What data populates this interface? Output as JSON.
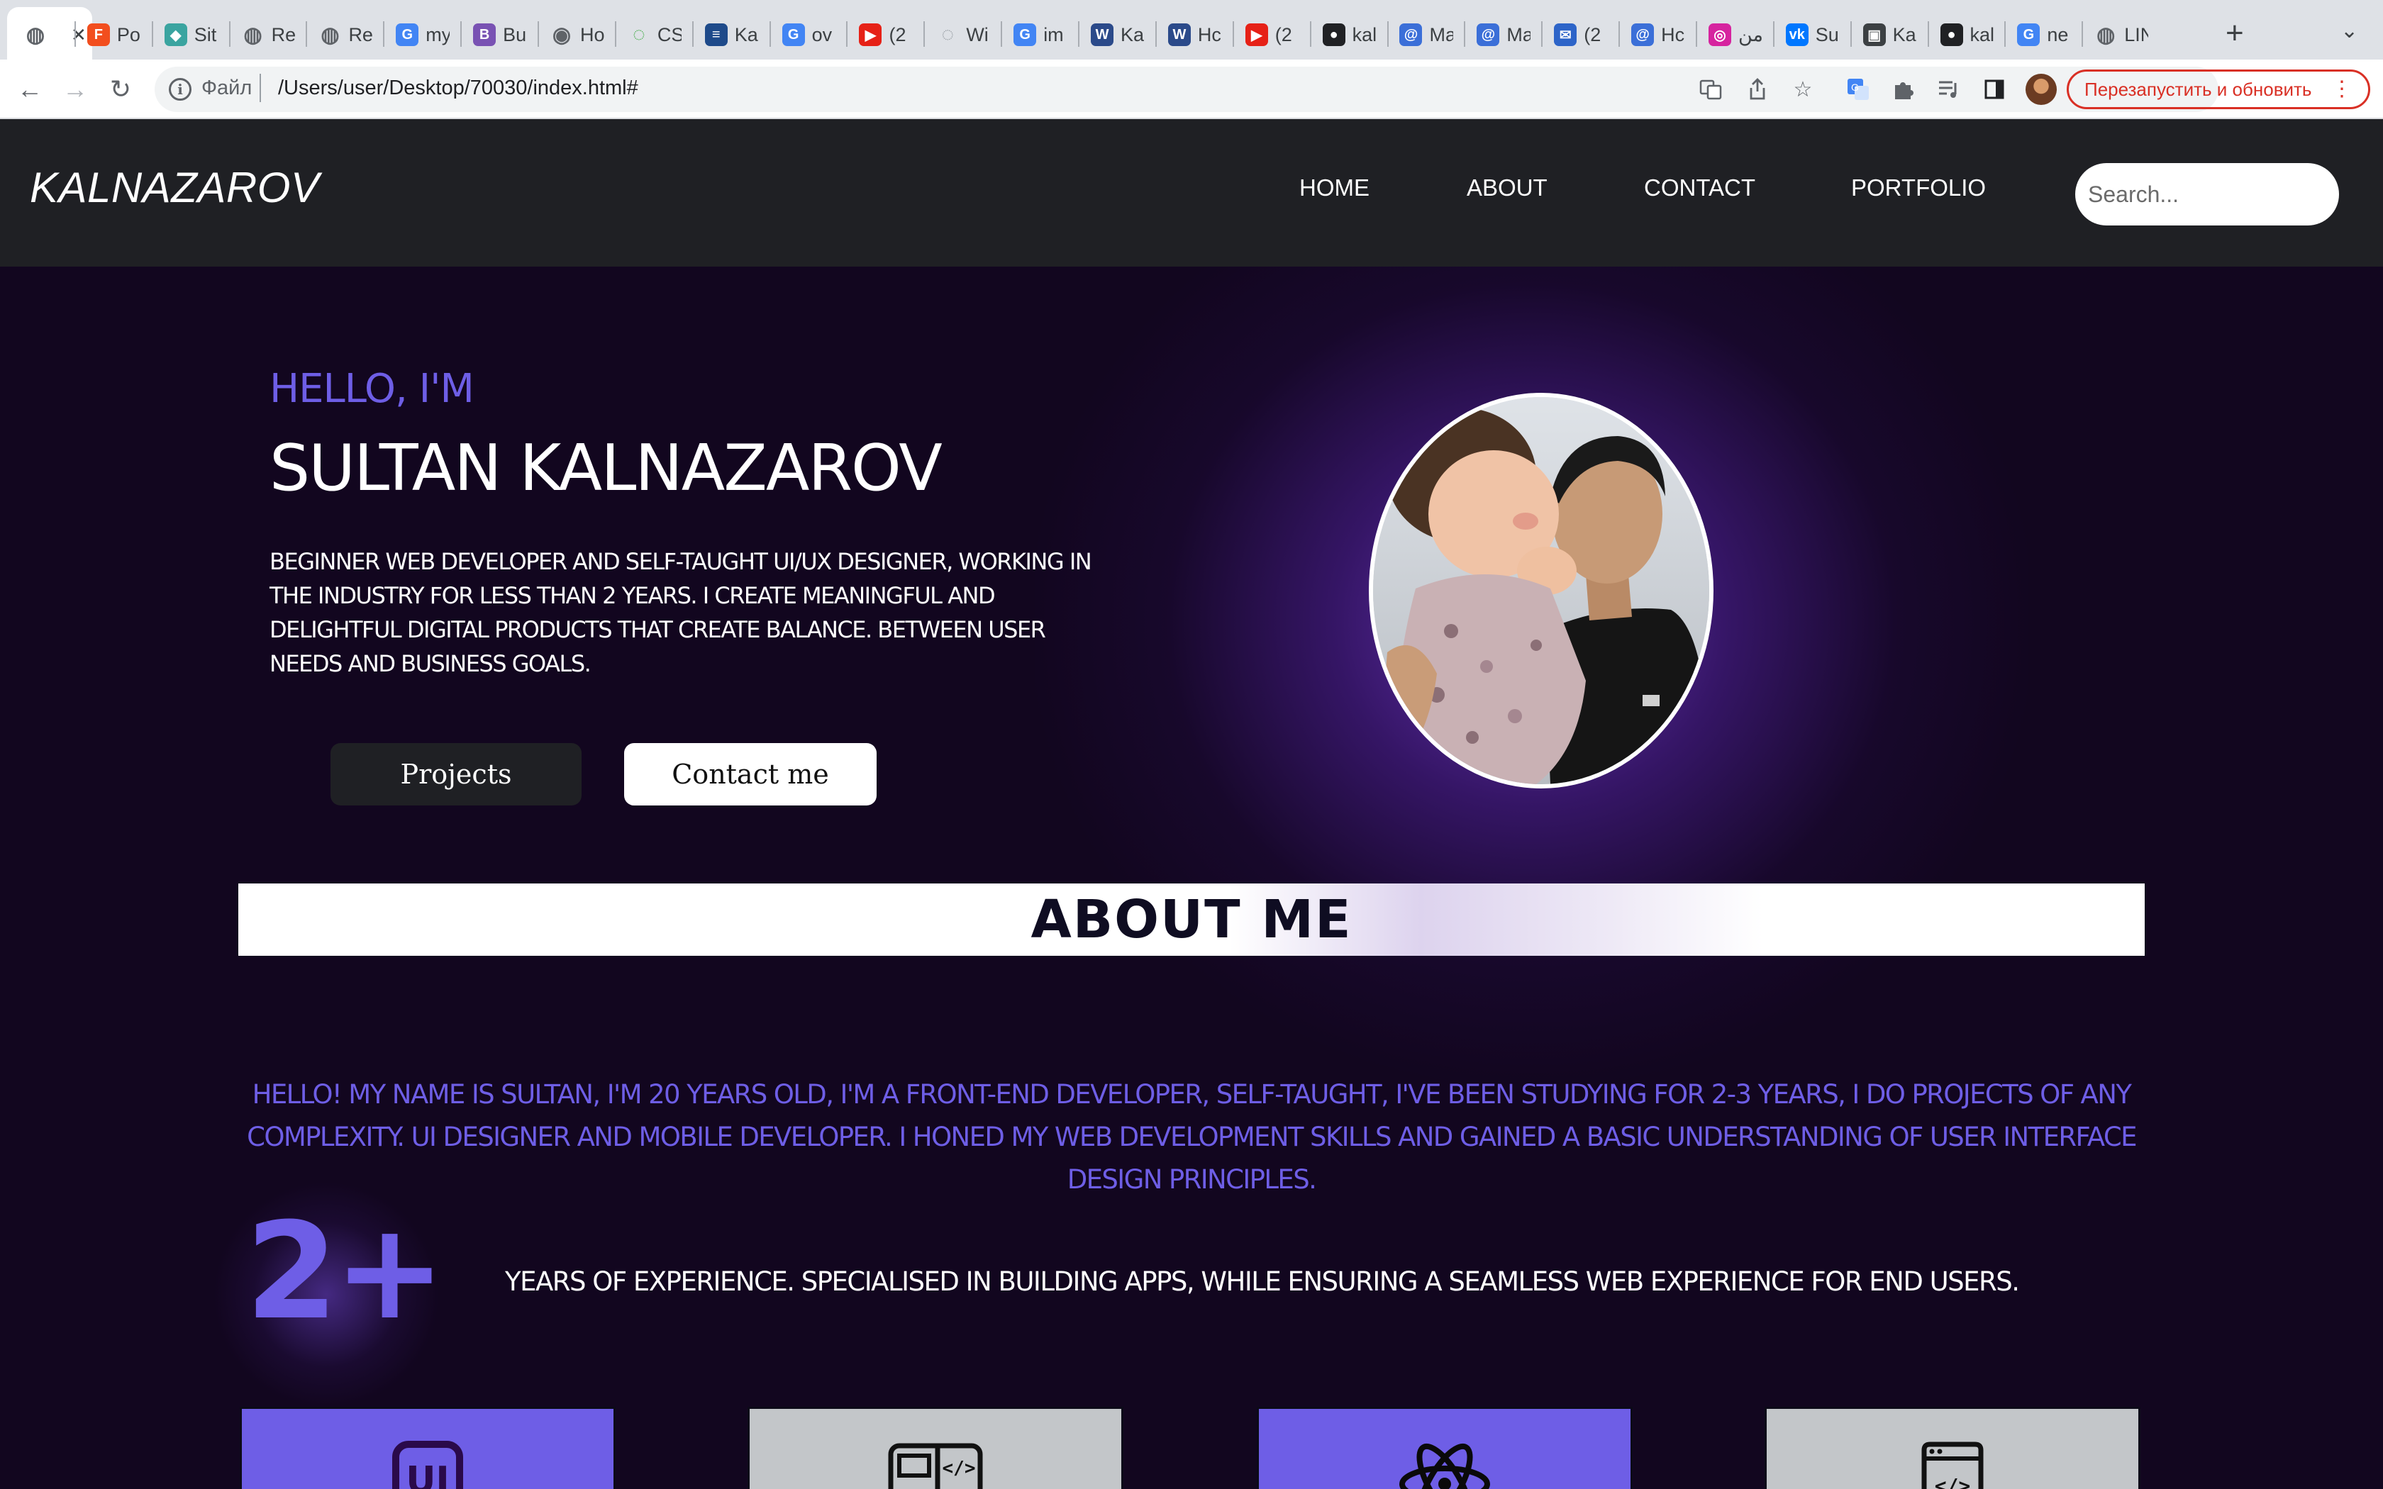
{
  "browser": {
    "tabs": [
      {
        "icon": "globe-icon",
        "title": "",
        "active": true
      },
      {
        "icon": "figma-icon",
        "title": "Po"
      },
      {
        "icon": "sitepoint-icon",
        "title": "Sit"
      },
      {
        "icon": "globe-icon",
        "title": "Re"
      },
      {
        "icon": "globe-icon",
        "title": "Re"
      },
      {
        "icon": "google-icon",
        "title": "my"
      },
      {
        "icon": "bootstrap-icon",
        "title": "Bu"
      },
      {
        "icon": "chrome-icon",
        "title": "Ho"
      },
      {
        "icon": "css-icon",
        "title": "CS"
      },
      {
        "icon": "stackoverflow-icon",
        "title": "Ka"
      },
      {
        "icon": "google-icon",
        "title": "ov"
      },
      {
        "icon": "youtube-icon",
        "title": "(2"
      },
      {
        "icon": "loading-icon",
        "title": "Wi"
      },
      {
        "icon": "google-icon",
        "title": "im"
      },
      {
        "icon": "wordreference-icon",
        "title": "Ka"
      },
      {
        "icon": "wordreference-icon",
        "title": "Hc"
      },
      {
        "icon": "youtube-icon",
        "title": "(2"
      },
      {
        "icon": "github-icon",
        "title": "kal"
      },
      {
        "icon": "mail-icon",
        "title": "Ma"
      },
      {
        "icon": "mail-icon",
        "title": "Ma"
      },
      {
        "icon": "envelope-icon",
        "title": "(2"
      },
      {
        "icon": "mail-icon",
        "title": "Hc"
      },
      {
        "icon": "instagram-icon",
        "title": "من"
      },
      {
        "icon": "vk-icon",
        "title": "Su"
      },
      {
        "icon": "app-icon",
        "title": "Ka"
      },
      {
        "icon": "github-icon",
        "title": "kal"
      },
      {
        "icon": "google-icon",
        "title": "ne"
      },
      {
        "icon": "globe-icon",
        "title": "LIN"
      }
    ],
    "url_scheme": "Файл",
    "url": "/Users/user/Desktop/70030/index.html#",
    "relaunch_label": "Перезапустить и обновить"
  },
  "site": {
    "logo": "KALNAZAROV",
    "nav": [
      "HOME",
      "ABOUT",
      "CONTACT",
      "PORTFOLIO"
    ],
    "search_placeholder": "Search..."
  },
  "hero": {
    "greeting": "HELLO, I'M",
    "name": "SULTAN KALNAZAROV",
    "bio": "BEGINNER WEB DEVELOPER AND SELF-TAUGHT UI/UX DESIGNER, WORKING IN THE INDUSTRY FOR LESS THAN 2 YEARS. I CREATE MEANINGFUL AND DELIGHTFUL DIGITAL PRODUCTS THAT CREATE BALANCE. BETWEEN USER NEEDS AND BUSINESS GOALS.",
    "projects_label": "Projects",
    "contact_label": "Contact me"
  },
  "about": {
    "title": "ABOUT ME",
    "text": "HELLO! MY NAME IS SULTAN, I'M 20 YEARS OLD, I'M A FRONT-END DEVELOPER, SELF-TAUGHT, I'VE BEEN STUDYING FOR 2-3 YEARS, I DO PROJECTS OF ANY COMPLEXITY. UI DESIGNER AND MOBILE DEVELOPER. I HONED MY WEB DEVELOPMENT SKILLS AND GAINED A BASIC UNDERSTANDING OF USER INTERFACE DESIGN PRINCIPLES.",
    "experience_number": "2+",
    "experience_text": "YEARS OF EXPERIENCE. SPECIALISED IN BUILDING APPS, WHILE ENSURING A SEAMLESS WEB EXPERIENCE FOR END USERS."
  },
  "skills": [
    {
      "icon": "ui-icon",
      "color": "#6e5ee6"
    },
    {
      "icon": "code-browser-icon",
      "color": "#c3c6c9"
    },
    {
      "icon": "react-atom-icon",
      "color": "#6e5ee6"
    },
    {
      "icon": "code-window-icon",
      "color": "#c3c6c9"
    }
  ],
  "colors": {
    "accent": "#6e5ee6",
    "header_bg": "#1f2024",
    "page_bg": "#12061f"
  }
}
